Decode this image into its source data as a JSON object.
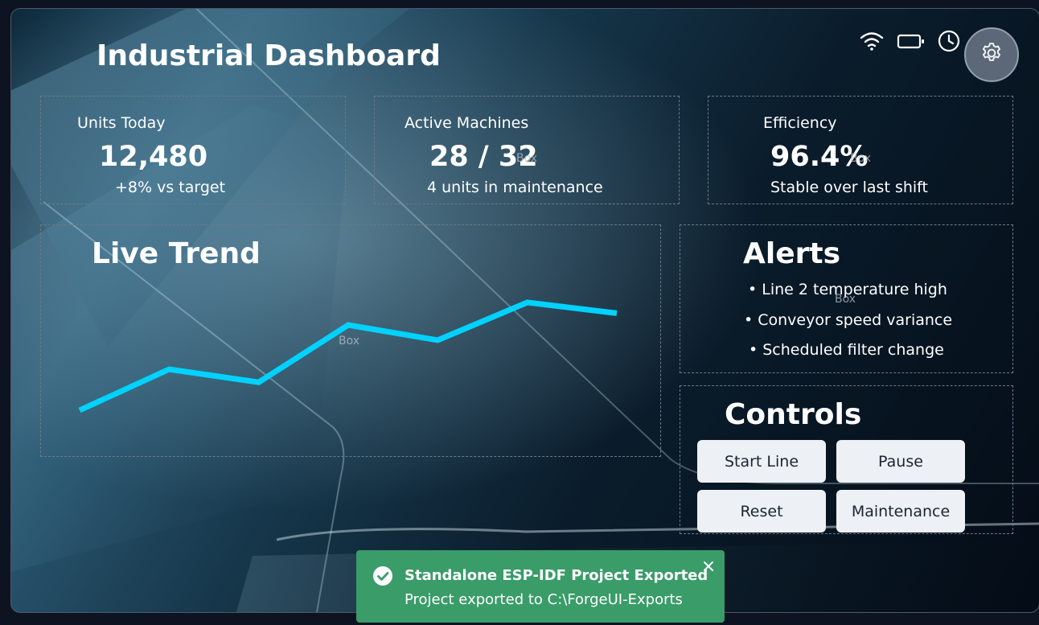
{
  "dashboard": {
    "title": "Industrial Dashboard"
  },
  "status_icons": [
    "wifi-icon",
    "battery-icon",
    "clock-icon"
  ],
  "settings": {
    "icon": "gear-icon"
  },
  "placeholder_label": "Box",
  "kpis": [
    {
      "label": "Units Today",
      "value": "12,480",
      "sub": "+8% vs target"
    },
    {
      "label": "Active Machines",
      "value": "28 / 32",
      "sub": "4 units in maintenance"
    },
    {
      "label": "Efficiency",
      "value": "96.4%",
      "sub": "Stable over last shift"
    }
  ],
  "trend": {
    "title": "Live Trend",
    "line_color": "#00d2ff"
  },
  "chart_data": {
    "type": "line",
    "values": [
      0,
      0.38,
      0.26,
      0.79,
      0.65,
      1.0,
      0.9
    ],
    "grid": false,
    "color": "#00d2ff"
  },
  "alerts": {
    "title": "Alerts",
    "items": [
      "• Line 2 temperature high",
      "• Conveyor speed variance",
      "• Scheduled filter change"
    ]
  },
  "controls": {
    "title": "Controls",
    "buttons": [
      "Start Line",
      "Pause",
      "Reset",
      "Maintenance"
    ]
  },
  "toast": {
    "title": "Standalone ESP-IDF Project Exported",
    "message": "Project exported to C:\\ForgeUI-Exports",
    "color": "#3a9c68"
  }
}
